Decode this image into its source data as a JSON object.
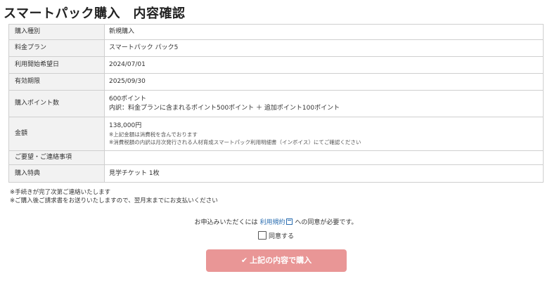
{
  "page": {
    "title": "スマートパック購入　内容確認"
  },
  "table": {
    "rows": [
      {
        "label": "購入種別",
        "value": "新規購入"
      },
      {
        "label": "料金プラン",
        "value": "スマートパック パック5"
      },
      {
        "label": "利用開始希望日",
        "value": "2024/07/01"
      },
      {
        "label": "有効期限",
        "value": "2025/09/30"
      },
      {
        "label": "購入ポイント数",
        "value": "600ポイント",
        "detail": "内訳：料金プランに含まれるポイント500ポイント ＋ 追加ポイント100ポイント"
      },
      {
        "label": "金額",
        "value": "138,000円",
        "note1": "※上記金額は消費税を含んでおります",
        "note2": "※消費税額の内訳は月次発行される人材育成スマートパック利用明細書（インボイス）にてご確認ください"
      },
      {
        "label": "ご要望・ご連絡事項",
        "value": ""
      },
      {
        "label": "購入特典",
        "value": "見学チケット 1枚"
      }
    ]
  },
  "notes": {
    "line1": "※手続きが完了次第ご連絡いたします",
    "line2": "※ご購入後ご請求書をお送りいたしますので、翌月末までにお支払いください"
  },
  "agreement": {
    "prefix": "お申込みいただくには",
    "link": "利用規約",
    "suffix": "への同意が必要です。",
    "checkbox_label": "同意する",
    "checked": false
  },
  "button": {
    "label": "上記の内容で購入",
    "icon": "✔",
    "color": "#e99696"
  }
}
